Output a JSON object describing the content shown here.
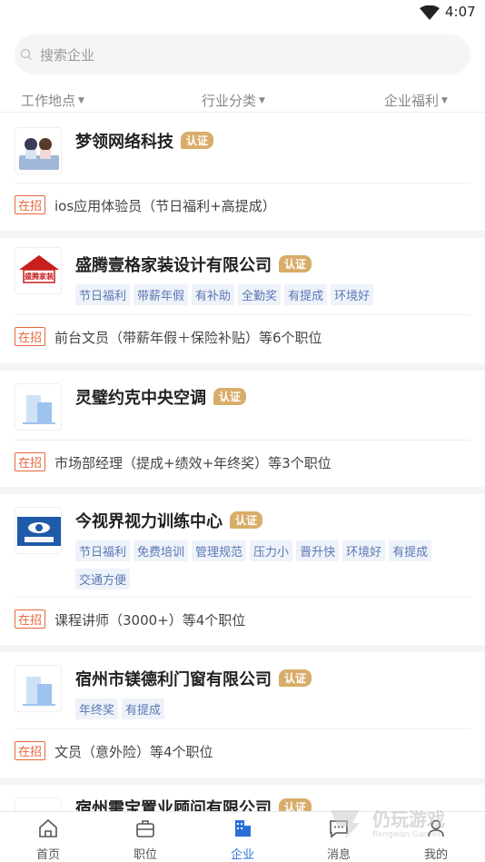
{
  "status": {
    "time": "4:07"
  },
  "search": {
    "placeholder": "搜索企业"
  },
  "filters": [
    {
      "label": "工作地点"
    },
    {
      "label": "行业分类"
    },
    {
      "label": "企业福利"
    }
  ],
  "badge_label": "认证",
  "hiring_label": "在招",
  "companies": [
    {
      "name": "梦领网络科技",
      "tags": [],
      "job": "ios应用体验员（节日福利+高提成）",
      "logo": "illustration"
    },
    {
      "name": "盛腾壹格家装设计有限公司",
      "tags": [
        "节日福利",
        "带薪年假",
        "有补助",
        "全勤奖",
        "有提成",
        "环境好"
      ],
      "job": "前台文员（带薪年假＋保险补贴）等6个职位",
      "logo": "house",
      "logo_text": "盛腾家装"
    },
    {
      "name": "灵璧约克中央空调",
      "tags": [],
      "job": "市场部经理（提成+绩效+年终奖）等3个职位",
      "logo": "building"
    },
    {
      "name": "今视界视力训练中心",
      "tags": [
        "节日福利",
        "免费培训",
        "管理规范",
        "压力小",
        "晋升快",
        "环境好",
        "有提成",
        "交通方便"
      ],
      "job": "课程讲师（3000+）等4个职位",
      "logo": "eye"
    },
    {
      "name": "宿州市镁德利门窗有限公司",
      "tags": [
        "年终奖",
        "有提成"
      ],
      "job": "文员（意外险）等4个职位",
      "logo": "building"
    },
    {
      "name": "宿州需宝置业顾问有限公司",
      "tags": [],
      "job": "",
      "logo": "illustration"
    }
  ],
  "tabs": [
    {
      "label": "首页",
      "icon": "home-icon"
    },
    {
      "label": "职位",
      "icon": "briefcase-icon"
    },
    {
      "label": "企业",
      "icon": "company-icon",
      "active": true
    },
    {
      "label": "消息",
      "icon": "message-icon"
    },
    {
      "label": "我的",
      "icon": "profile-icon"
    }
  ],
  "watermark": {
    "text": "仍玩游戏",
    "sub": "Rengwan Games"
  },
  "colors": {
    "accent": "#2b6fd6",
    "badge": "#d8ad6a",
    "hiring": "#e8663c",
    "tag_text": "#5a78b4",
    "tag_bg": "#eef2f9"
  }
}
